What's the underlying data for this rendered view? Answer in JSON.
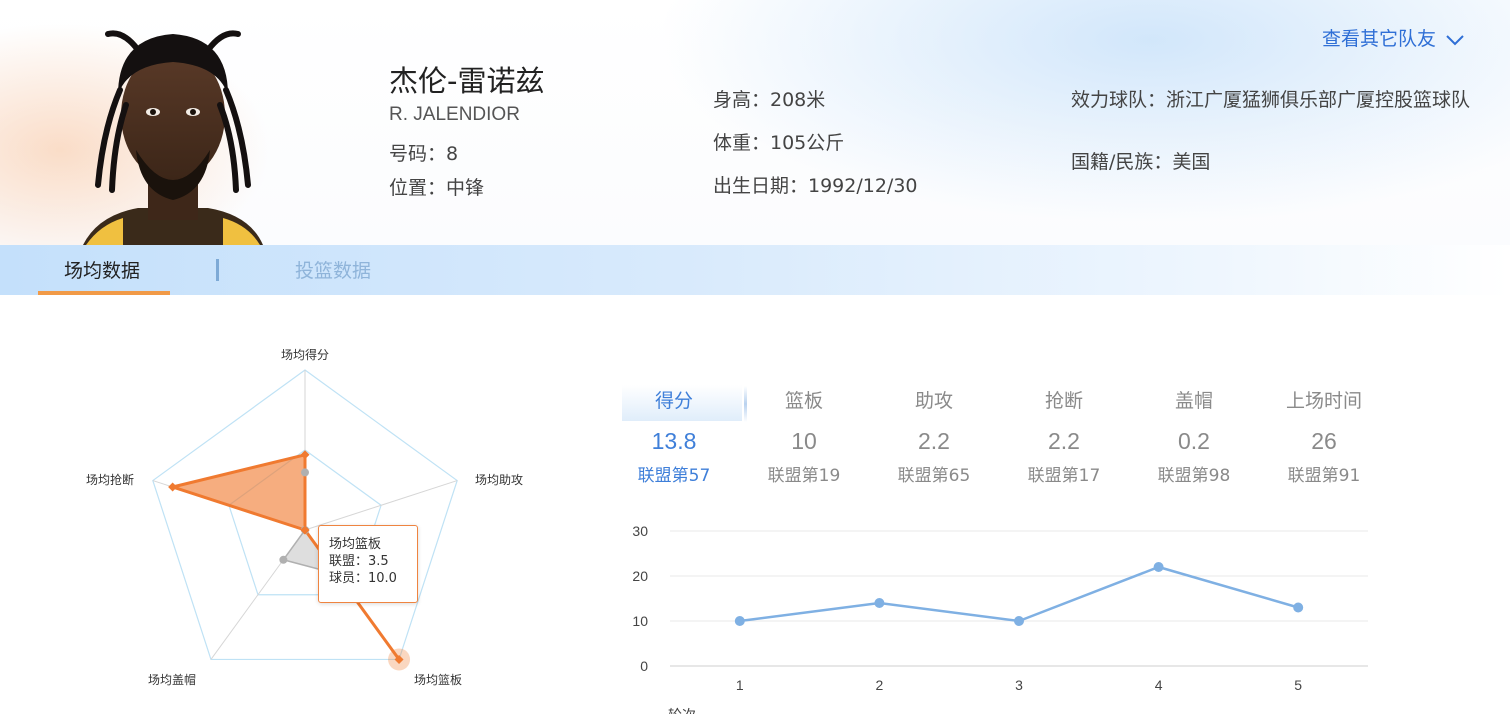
{
  "player": {
    "name": "杰伦-雷诺兹",
    "english_name": "R. JALENDIOR",
    "number": "号码：8",
    "position": "位置：中锋",
    "height": "身高：208米",
    "weight": "体重：105公斤",
    "birthday": "出生日期：1992/12/30",
    "team": "效力球队：浙江广厦猛狮俱乐部广厦控股篮球队",
    "nationality": "国籍/民族：美国"
  },
  "header": {
    "other_teammates": "查看其它队友"
  },
  "tabs": [
    {
      "label": "场均数据",
      "active": true
    },
    {
      "label": "投篮数据",
      "active": false
    }
  ],
  "radar": {
    "axes": [
      "场均得分",
      "场均助攻",
      "场均篮板",
      "场均盖帽",
      "场均抢断"
    ],
    "player_normalized": [
      0.47,
      0.0,
      1.0,
      0.0,
      0.87
    ],
    "league_normalized": [
      0.36,
      0.0,
      0.34,
      0.23,
      0.0
    ],
    "player_color": "#f07a30",
    "league_color": "#b0b0b0",
    "tooltip": {
      "title": "场均篮板",
      "league": "联盟：3.5",
      "player": "球员：10.0"
    }
  },
  "stats": [
    {
      "label": "得分",
      "value": "13.8",
      "rank": "联盟第57",
      "active": true
    },
    {
      "label": "篮板",
      "value": "10",
      "rank": "联盟第19",
      "active": false
    },
    {
      "label": "助攻",
      "value": "2.2",
      "rank": "联盟第65",
      "active": false
    },
    {
      "label": "抢断",
      "value": "2.2",
      "rank": "联盟第17",
      "active": false
    },
    {
      "label": "盖帽",
      "value": "0.2",
      "rank": "联盟第98",
      "active": false
    },
    {
      "label": "上场时间",
      "value": "26",
      "rank": "联盟第91",
      "active": false
    }
  ],
  "chart_data": {
    "type": "line",
    "x": [
      1,
      2,
      3,
      4,
      5
    ],
    "series": [
      {
        "values": [
          10,
          14,
          10,
          22,
          13
        ]
      }
    ],
    "xlabel": "轮次",
    "ylabel": "",
    "ylim": [
      0,
      30
    ],
    "yticks": [
      0,
      10,
      20,
      30
    ],
    "grid": true,
    "color": "#7fb0e3"
  },
  "colors": {
    "accent_blue": "#3f7fd9",
    "tab_underline": "#f19a47",
    "grid_line": "#bfe2f5"
  }
}
